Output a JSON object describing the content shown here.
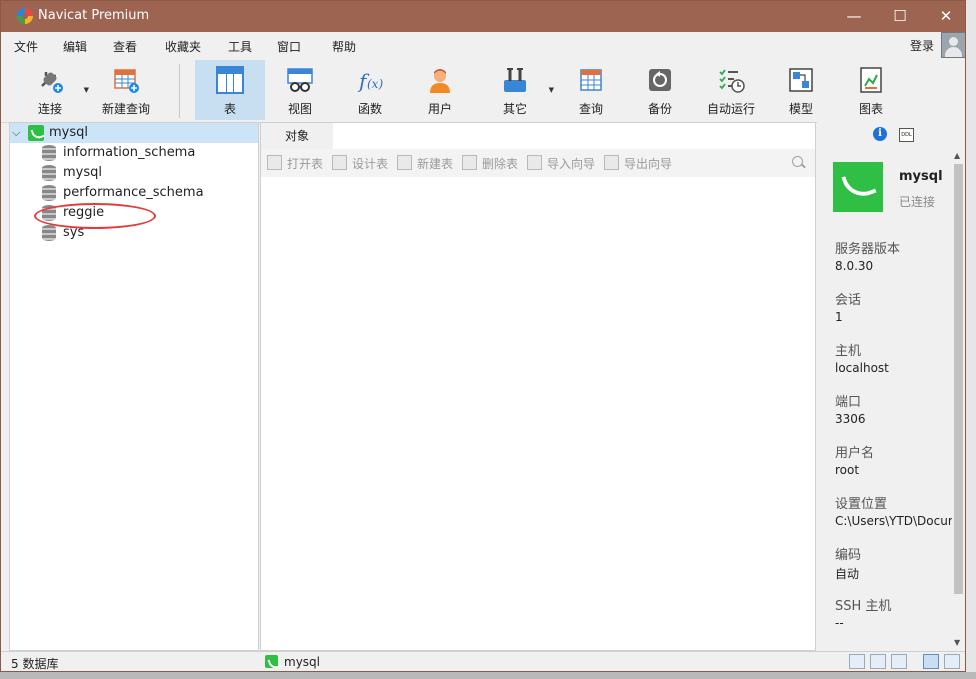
{
  "window": {
    "title": "Navicat Premium",
    "minimize": "—",
    "maximize": "☐",
    "close": "✕"
  },
  "menu": [
    "文件",
    "编辑",
    "查看",
    "收藏夹",
    "工具",
    "窗口",
    "帮助"
  ],
  "login_label": "登录",
  "toolbar": {
    "connect": "连接",
    "new_query": "新建查询",
    "table": "表",
    "view": "视图",
    "function": "函数",
    "user": "用户",
    "other": "其它",
    "query": "查询",
    "backup": "备份",
    "auto_run": "自动运行",
    "model": "模型",
    "chart": "图表"
  },
  "tree": {
    "connection": "mysql",
    "databases": [
      "information_schema",
      "mysql",
      "performance_schema",
      "reggie",
      "sys"
    ]
  },
  "objects": {
    "tab": "对象",
    "actions": [
      "打开表",
      "设计表",
      "新建表",
      "删除表",
      "导入向导",
      "导出向导"
    ]
  },
  "info": {
    "name": "mysql",
    "status": "已连接",
    "props": [
      {
        "label": "服务器版本",
        "value": "8.0.30"
      },
      {
        "label": "会话",
        "value": "1"
      },
      {
        "label": "主机",
        "value": "localhost"
      },
      {
        "label": "端口",
        "value": "3306"
      },
      {
        "label": "用户名",
        "value": "root"
      },
      {
        "label": "设置位置",
        "value": "C:\\Users\\YTD\\Docur"
      },
      {
        "label": "编码",
        "value": "自动"
      },
      {
        "label": "SSH 主机",
        "value": "--"
      }
    ]
  },
  "status": {
    "db_count": "5 数据库",
    "connection": "mysql"
  },
  "colors": {
    "titlebar": "#9c6451",
    "selection": "#cce4f7",
    "accent": "#3a86d6",
    "mysql_green": "#2fbf44",
    "annotation": "#e23b3b"
  }
}
